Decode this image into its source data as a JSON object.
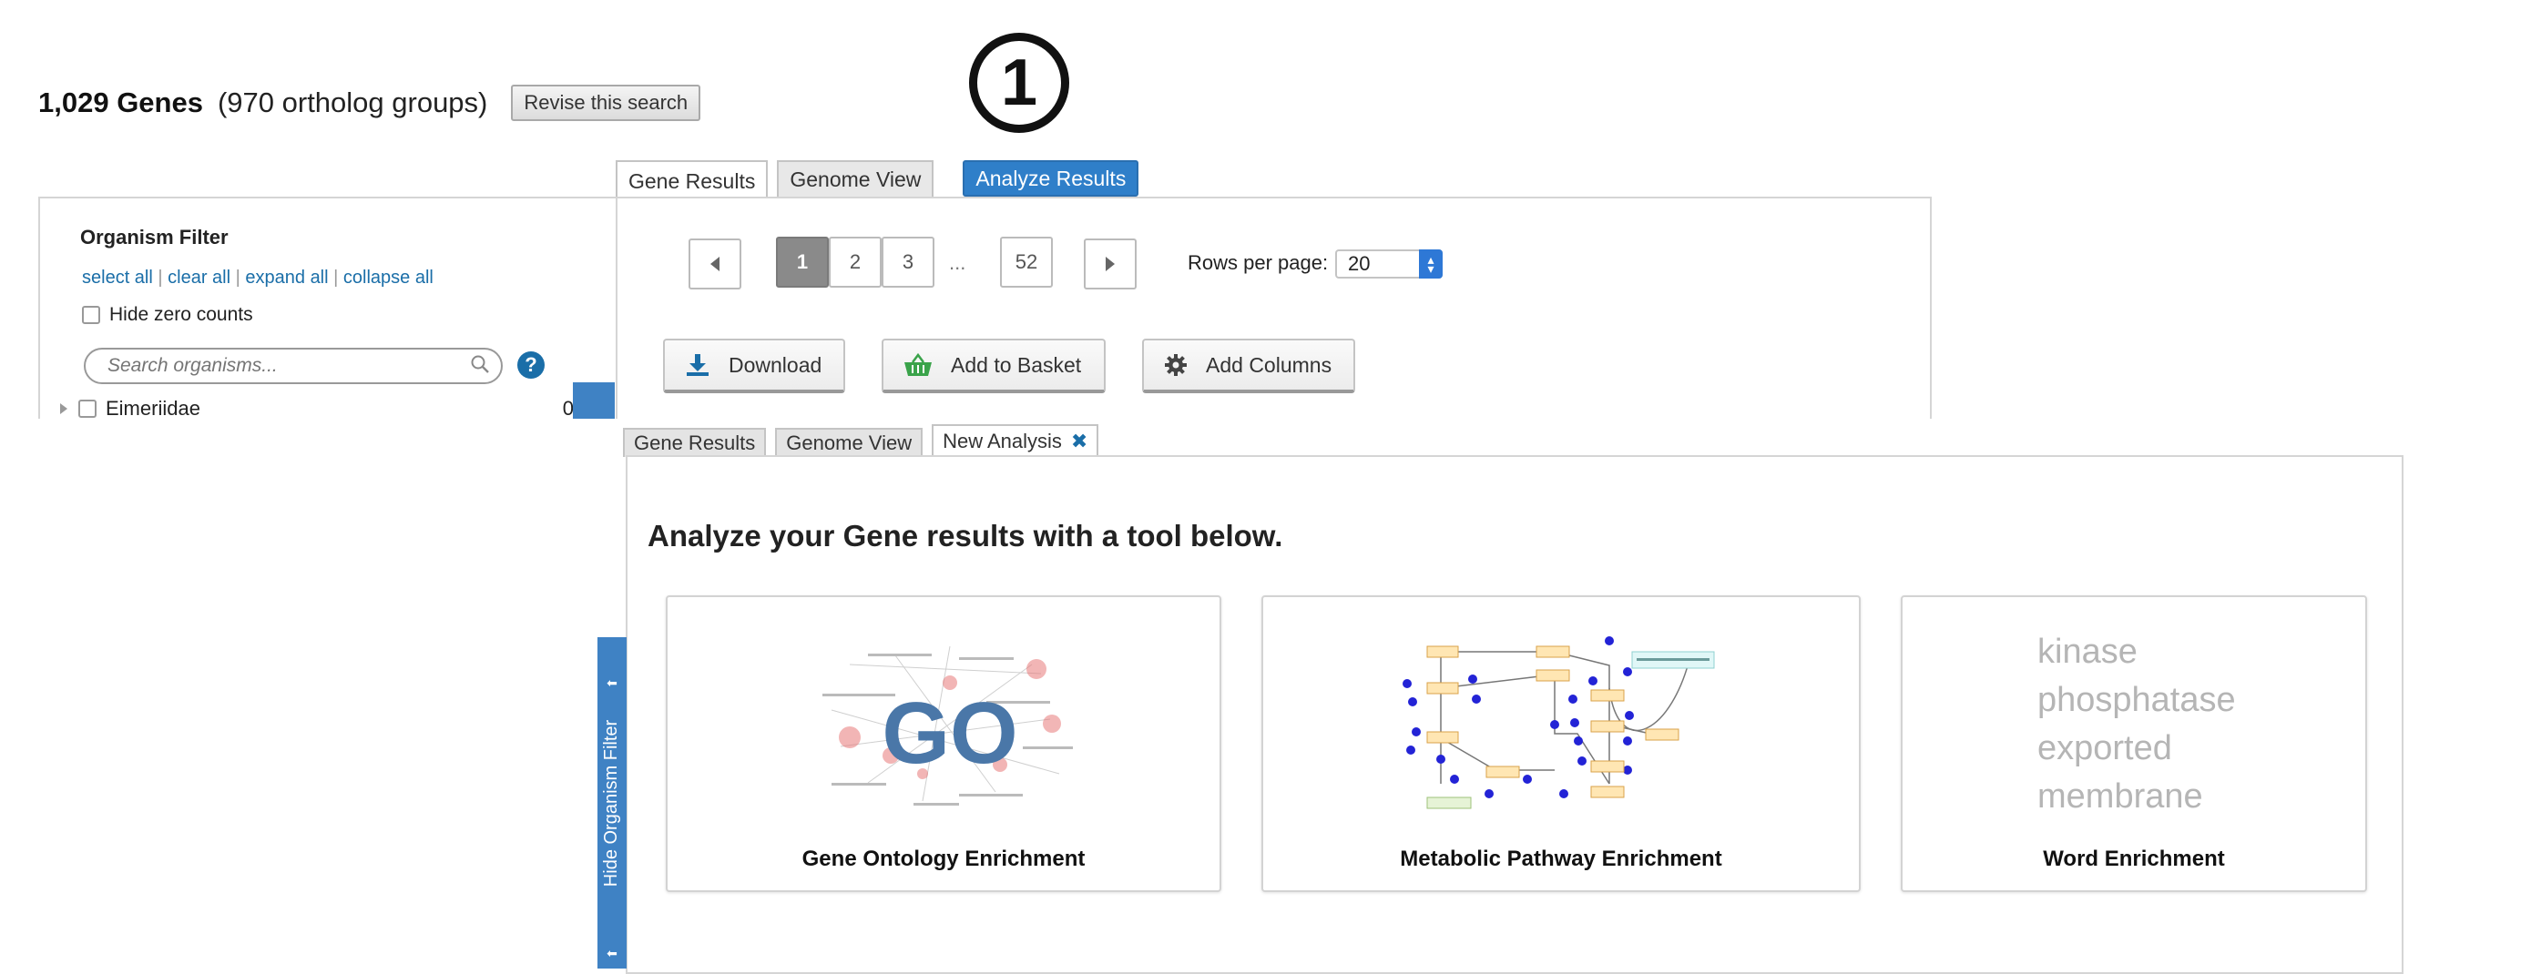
{
  "header": {
    "count": "1,029 Genes",
    "subtitle": "(970 ortholog groups)",
    "revise_label": "Revise this search",
    "step_marker": "1"
  },
  "top_tabs": [
    {
      "label": "Gene Results",
      "active": true
    },
    {
      "label": "Genome View",
      "active": false
    },
    {
      "label": "Analyze Results",
      "highlighted": true
    }
  ],
  "organism_filter": {
    "title": "Organism Filter",
    "links": [
      "select all",
      "clear all",
      "expand all",
      "collapse all"
    ],
    "link_separator": "|",
    "hide_zero_label": "Hide zero counts",
    "hide_zero_checked": false,
    "search_placeholder": "Search organisms...",
    "help_glyph": "?",
    "tree": [
      {
        "name": "Eimeriidae",
        "count": "0",
        "checked": false
      }
    ]
  },
  "pagination": {
    "pages": [
      "1",
      "2",
      "3",
      "...",
      "52"
    ],
    "current": "1",
    "rows_label": "Rows per page:",
    "rows_value": "20"
  },
  "actions": {
    "download": "Download",
    "basket": "Add to Basket",
    "columns": "Add Columns"
  },
  "sidebar_toggle": {
    "label": "Hide Organism Filter"
  },
  "second_tabs": [
    {
      "label": "Gene Results"
    },
    {
      "label": "Genome View"
    },
    {
      "label": "New Analysis",
      "active": true,
      "closable": true
    }
  ],
  "analysis": {
    "heading": "Analyze your Gene results with a tool below.",
    "tools": [
      {
        "name": "Gene Ontology Enrichment",
        "thumb_text": "GO"
      },
      {
        "name": "Metabolic Pathway Enrichment"
      },
      {
        "name": "Word Enrichment",
        "words": [
          "kinase",
          "phosphatase",
          "exported",
          "membrane"
        ]
      }
    ]
  },
  "colors": {
    "accent_blue": "#2f7fc9",
    "link_blue": "#1a6ea8",
    "basket_green": "#3aa34a",
    "go_blue": "#4a77a8",
    "go_red": "#e87a7a"
  }
}
